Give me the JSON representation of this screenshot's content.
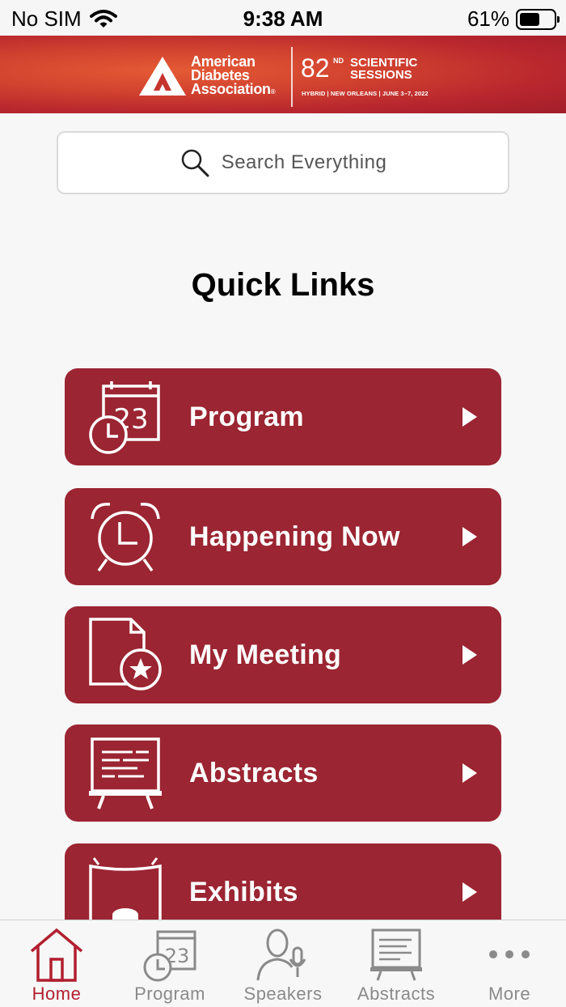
{
  "status_bar": {
    "carrier": "No SIM",
    "time": "9:38 AM",
    "battery": "61%",
    "battery_level": 0.61
  },
  "banner": {
    "org_line1": "American",
    "org_line2": "Diabetes",
    "org_line3": "Association",
    "org_mark": "®",
    "edition": "82",
    "edition_sup": "ND",
    "sessions_line1": "SCIENTIFIC",
    "sessions_line2": "SESSIONS",
    "meta": "HYBRID | NEW ORLEANS | JUNE 3–7, 2022",
    "colors": {
      "primary": "#b8262e",
      "highlight": "#e45a35"
    }
  },
  "search": {
    "placeholder": "Search Everything",
    "icon": "magnifier-icon"
  },
  "main": {
    "heading": "Quick Links",
    "links": [
      {
        "label": "Program",
        "icon": "calendar-clock-icon"
      },
      {
        "label": "Happening Now",
        "icon": "alarm-clock-icon"
      },
      {
        "label": "My Meeting",
        "icon": "document-star-icon"
      },
      {
        "label": "Abstracts",
        "icon": "easel-board-icon"
      },
      {
        "label": "Exhibits",
        "icon": "exhibit-booth-icon"
      }
    ],
    "link_color": "#9b2532"
  },
  "tabbar": {
    "items": [
      {
        "label": "Home",
        "icon": "home-icon",
        "active": true
      },
      {
        "label": "Program",
        "icon": "calendar-clock-icon",
        "active": false
      },
      {
        "label": "Speakers",
        "icon": "speaker-mic-icon",
        "active": false
      },
      {
        "label": "Abstracts",
        "icon": "easel-board-icon",
        "active": false
      },
      {
        "label": "More",
        "icon": "ellipsis-icon",
        "active": false
      }
    ],
    "active_color": "#b21f2f",
    "inactive_color": "#8a8a8a"
  },
  "calendar_number": "23"
}
